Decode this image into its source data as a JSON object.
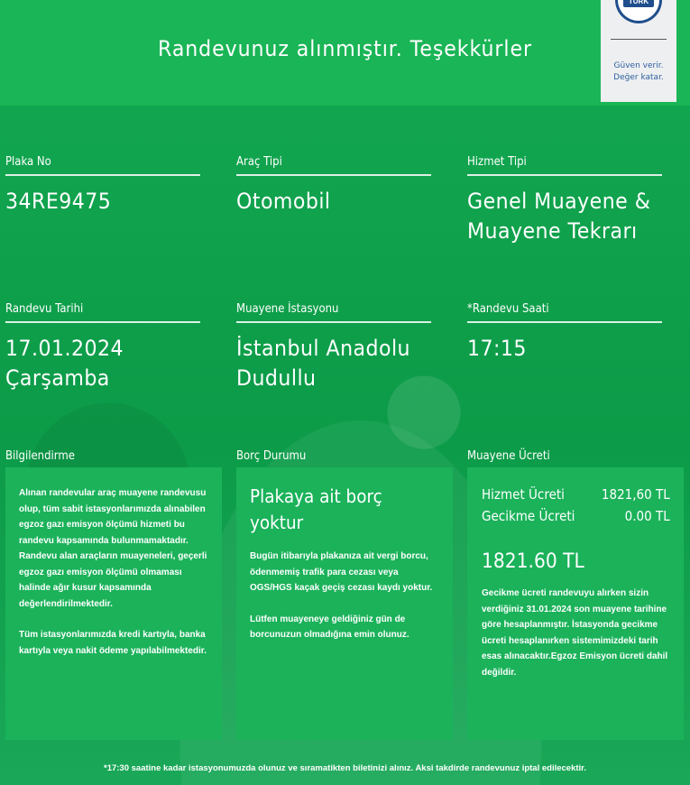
{
  "header": {
    "title": "Randevunuz alınmıştır. Teşekkürler"
  },
  "badge": {
    "logo_text": "TÜRK",
    "tagline_1": "Güven verir.",
    "tagline_2": "Değer katar."
  },
  "fields": {
    "plaka": {
      "label": "Plaka No",
      "value": "34RE9475"
    },
    "arac_tipi": {
      "label": "Araç Tipi",
      "value": "Otomobil"
    },
    "hizmet_tipi": {
      "label": "Hizmet Tipi",
      "value": "Genel Muayene &\nMuayene Tekrarı"
    },
    "randevu_tarihi": {
      "label": "Randevu Tarihi",
      "value": "17.01.2024\nÇarşamba"
    },
    "istasyon": {
      "label": "Muayene İstasyonu",
      "value": "İstanbul Anadolu\nDudullu"
    },
    "randevu_saati": {
      "label": "*Randevu Saati",
      "value": "17:15"
    }
  },
  "bilgilendirme": {
    "label": "Bilgilendirme",
    "paragraph_1": "Alınan randevular araç muayene randevusu olup, tüm sabit istasyonlarımızda alınabilen egzoz gazı emisyon ölçümü hizmeti bu randevu kapsamında bulunmamaktadır. Randevu alan araçların muayeneleri, geçerli egzoz gazı emisyon ölçümü olmaması halinde ağır kusur kapsamında değerlendirilmektedir.",
    "paragraph_2": "Tüm istasyonlarımızda kredi kartıyla, banka kartıyla veya nakit ödeme yapılabilmektedir."
  },
  "borc": {
    "label": "Borç Durumu",
    "title": "Plakaya ait borç yoktur",
    "paragraph_1": "Bugün itibarıyla plakanıza ait vergi borcu, ödenmemiş trafik para cezası veya OGS/HGS kaçak geçiş cezası kaydı yoktur.",
    "paragraph_2": "Lütfen muayeneye geldiğiniz gün de borcunuzun olmadığına emin olunuz."
  },
  "ucret": {
    "label": "Muayene Ücreti",
    "hizmet_label": "Hizmet Ücreti",
    "hizmet_value": "1821,60 TL",
    "gecikme_label": "Gecikme Ücreti",
    "gecikme_value": "0.00 TL",
    "total": "1821.60 TL",
    "note": "Gecikme ücreti randevuyu alırken sizin verdiğiniz 31.01.2024 son muayene tarihine göre hesaplanmıştır. İstasyonda gecikme ücreti hesaplanırken sistemimizdeki tarih esas alınacaktır.Egzoz Emisyon ücreti dahil değildir."
  },
  "footer": {
    "note": "*17:30 saatine kadar istasyonumuzda olunuz ve sıramatikten biletinizi alınız. Aksi takdirde randevunuz iptal edilecektir."
  },
  "colors": {
    "header_green": "#1ab556",
    "background_green": "#0c9b48",
    "panel_green": "#1bb25a",
    "badge_blue": "#1f4e8c"
  }
}
